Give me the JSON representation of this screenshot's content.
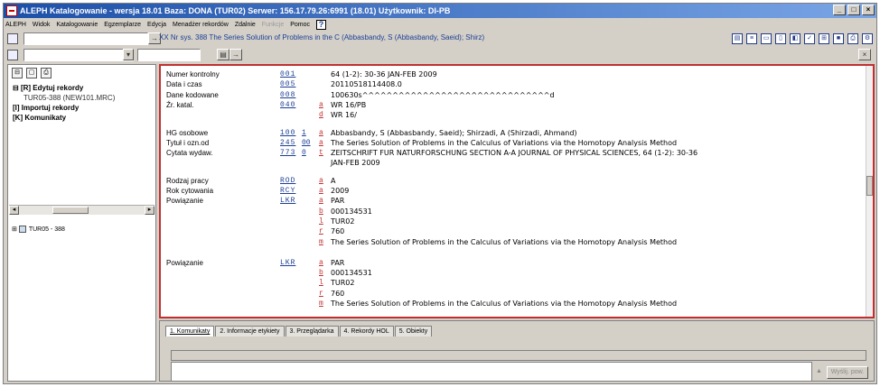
{
  "window": {
    "title": "ALEPH Katalogowanie - wersja 18.01 Baza: DONA (TUR02) Serwer: 156.17.79.26:6991 (18.01) Użytkownik: DI-PB",
    "buttons": [
      "_",
      "□",
      "×"
    ]
  },
  "menu": {
    "items": [
      "ALEPH",
      "Widok",
      "Katalogowanie",
      "Egzemplarze",
      "Edycja",
      "Menadżer rekordów",
      "Zdalnie"
    ],
    "disabled_item": "Funkcje",
    "last_item": "Pomoc",
    "help_icon": "?"
  },
  "toolbar": {
    "record_title": "XX Nr sys. 388 The Series Solution of Problems in the C (Abbasbandy, S (Abbasbandy, Saeid); Shirz)",
    "search_placeholder": "",
    "go_arrow": "→",
    "icons": [
      "new-doc-icon",
      "field-icon",
      "view-icon",
      "book-icon",
      "record-icon",
      "check-icon",
      "tree-icon",
      "save-icon",
      "print-icon",
      "settings-icon"
    ]
  },
  "left_panel": {
    "tree": [
      {
        "label": "[R] Edytuj rekordy",
        "bold": true
      },
      {
        "label": "TUR05-388 (NEW101.MRC)",
        "bold": false
      },
      {
        "label": "[I] Importuj rekordy",
        "bold": true
      },
      {
        "label": "[K] Komunikaty",
        "bold": true
      }
    ],
    "lower_item": "TUR05 - 388"
  },
  "record": {
    "fields": [
      {
        "label": "Numer kontrolny",
        "tag": "001",
        "ind": "",
        "sub": "",
        "value": "64 (1-2): 30-36 JAN-FEB 2009"
      },
      {
        "label": "Data i czas",
        "tag": "005",
        "ind": "",
        "sub": "",
        "value": "20110518114408.0"
      },
      {
        "label": "Dane kodowane",
        "tag": "008",
        "ind": "",
        "sub": "",
        "value": "100630s^^^^^^^^^^^^^^^^^^^^^^^^^^^^^^^d"
      },
      {
        "label": "Źr. katal.",
        "tag": "040",
        "ind": "",
        "sub": "a",
        "value": "WR 16/PB"
      },
      {
        "label": "",
        "tag": "",
        "ind": "",
        "sub": "d",
        "value": "WR 16/"
      },
      {
        "label": "HG osobowe",
        "tag": "100",
        "ind": "1",
        "sub": "a",
        "value": "Abbasbandy, S (Abbasbandy, Saeid); Shirzadi, A (Shirzadi, Ahmand)"
      },
      {
        "label": "Tytuł i ozn.od",
        "tag": "245",
        "ind": "00",
        "sub": "a",
        "value": "The Series Solution of Problems in the Calculus of Variations via the Homotopy Analysis Method"
      },
      {
        "label": "Cytata wydaw.",
        "tag": "773",
        "ind": "0",
        "sub": "t",
        "value": "ZEITSCHRIFT FUR NATURFORSCHUNG SECTION A-A JOURNAL OF PHYSICAL SCIENCES, 64 (1-2): 30-36"
      },
      {
        "label": "",
        "tag": "",
        "ind": "",
        "sub": "",
        "value": "JAN-FEB 2009"
      },
      {
        "label": "Rodzaj pracy",
        "tag": "ROD",
        "ind": "",
        "sub": "a",
        "value": "A"
      },
      {
        "label": "Rok cytowania",
        "tag": "RCY",
        "ind": "",
        "sub": "a",
        "value": "2009"
      },
      {
        "label": "Powiązanie",
        "tag": "LKR",
        "ind": "",
        "sub": "a",
        "value": "PAR"
      },
      {
        "label": "",
        "tag": "",
        "ind": "",
        "sub": "b",
        "value": "000134531"
      },
      {
        "label": "",
        "tag": "",
        "ind": "",
        "sub": "l",
        "value": "TUR02"
      },
      {
        "label": "",
        "tag": "",
        "ind": "",
        "sub": "r",
        "value": "760"
      },
      {
        "label": "",
        "tag": "",
        "ind": "",
        "sub": "m",
        "value": "The Series Solution of Problems in the Calculus of Variations via the Homotopy Analysis Method"
      },
      {
        "label": "Powiązanie",
        "tag": "LKR",
        "ind": "",
        "sub": "a",
        "value": "PAR"
      },
      {
        "label": "",
        "tag": "",
        "ind": "",
        "sub": "b",
        "value": "000134531"
      },
      {
        "label": "",
        "tag": "",
        "ind": "",
        "sub": "l",
        "value": "TUR02"
      },
      {
        "label": "",
        "tag": "",
        "ind": "",
        "sub": "r",
        "value": "760"
      },
      {
        "label": "",
        "tag": "",
        "ind": "",
        "sub": "m",
        "value": "The Series Solution of Problems in the Calculus of Variations via the Homotopy Analysis Method"
      }
    ]
  },
  "bottom": {
    "tabs": [
      "1. Komunikaty",
      "2. Informacje etykiety",
      "3. Przeglądarka",
      "4. Rekordy HOL",
      "5. Obiekty"
    ],
    "send_button": "Wyślij. pow."
  }
}
